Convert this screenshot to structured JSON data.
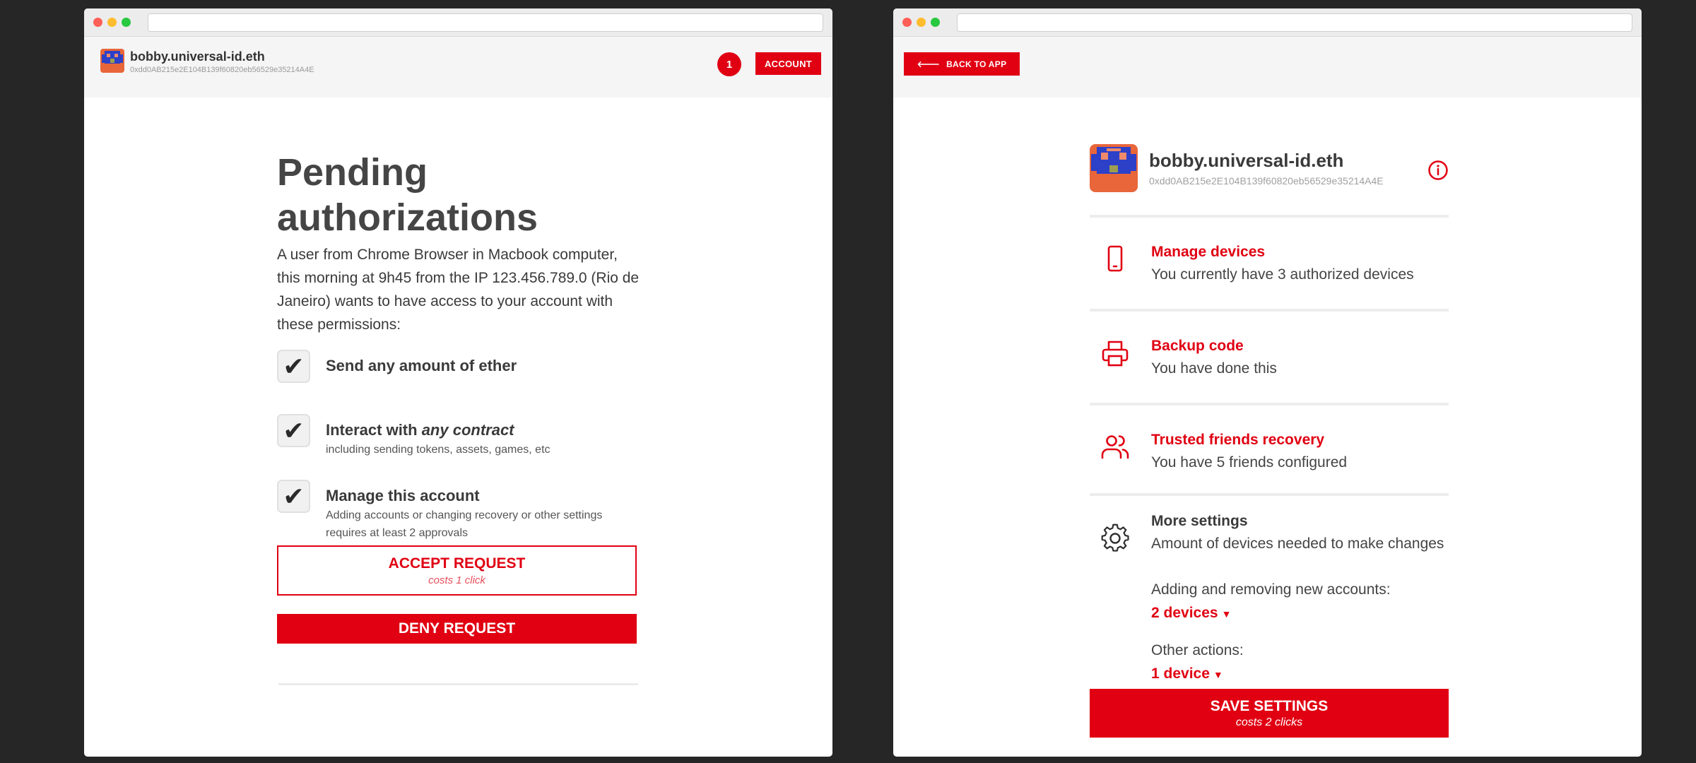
{
  "account": {
    "name": "bobby.universal-id.eth",
    "address": "0xdd0AB215e2E104B139f60820eb56529e35214A4E"
  },
  "left": {
    "notification_count": "1",
    "account_button": "ACCOUNT",
    "title": "Pending authorizations",
    "intro": "A user from Chrome Browser in Macbook computer, this morning at 9h45 from the IP 123.456.789.0 (Rio de Janeiro) wants to have access to your account with these permissions:",
    "permissions": [
      {
        "title": "Send any amount of ether",
        "checked": true
      },
      {
        "title_prefix": "Interact with ",
        "title_emphasis": "any contract",
        "description": "including sending tokens, assets, games, etc",
        "checked": true
      },
      {
        "title": "Manage this account",
        "description": "Adding accounts or changing recovery or other settings requires at least 2 approvals",
        "checked": true
      }
    ],
    "accept_label": "ACCEPT REQUEST",
    "accept_cost": "costs 1 click",
    "deny_label": "DENY REQUEST"
  },
  "right": {
    "back_button": "BACK TO APP",
    "settings": [
      {
        "icon": "phone-icon",
        "title": "Manage devices",
        "description": "You currently have 3 authorized devices"
      },
      {
        "icon": "printer-icon",
        "title": "Backup code",
        "description": "You have done this"
      },
      {
        "icon": "users-icon",
        "title": "Trusted friends recovery",
        "description": "You have 5 friends configured"
      }
    ],
    "more_settings": {
      "icon": "gear-icon",
      "title": "More settings",
      "description": "Amount of devices needed to make changes",
      "accounts_label": "Adding and removing new accounts:",
      "accounts_value": "2 devices",
      "other_label": "Other actions:",
      "other_value": "1 device"
    },
    "save_label": "SAVE SETTINGS",
    "save_cost": "costs 2 clicks"
  },
  "colors": {
    "accent": "#e00012",
    "background": "#262626"
  }
}
